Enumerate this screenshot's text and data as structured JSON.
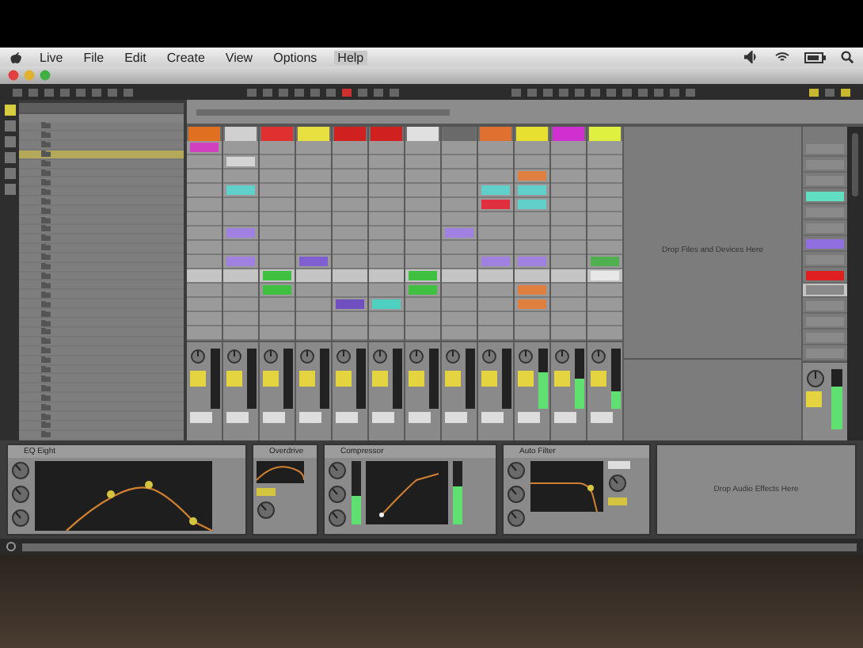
{
  "menu_bar": {
    "items": [
      {
        "label": "Live",
        "selected": false
      },
      {
        "label": "File",
        "selected": false
      },
      {
        "label": "Edit",
        "selected": false
      },
      {
        "label": "Create",
        "selected": false
      },
      {
        "label": "View",
        "selected": false
      },
      {
        "label": "Options",
        "selected": false
      },
      {
        "label": "Help",
        "selected": true
      }
    ]
  },
  "browser": {
    "items": [
      {
        "selected": false
      },
      {
        "selected": false
      },
      {
        "selected": false
      },
      {
        "selected": true
      },
      {
        "selected": false
      },
      {
        "selected": false
      },
      {
        "selected": false
      },
      {
        "selected": false
      },
      {
        "selected": false
      },
      {
        "selected": false
      },
      {
        "selected": false
      },
      {
        "selected": false
      },
      {
        "selected": false
      },
      {
        "selected": false
      },
      {
        "selected": false
      },
      {
        "selected": false
      },
      {
        "selected": false
      },
      {
        "selected": false
      },
      {
        "selected": false
      },
      {
        "selected": false
      },
      {
        "selected": false
      },
      {
        "selected": false
      },
      {
        "selected": false
      },
      {
        "selected": false
      },
      {
        "selected": false
      },
      {
        "selected": false
      },
      {
        "selected": false
      },
      {
        "selected": false
      },
      {
        "selected": false
      },
      {
        "selected": false
      },
      {
        "selected": false
      },
      {
        "selected": false
      },
      {
        "selected": false
      },
      {
        "selected": false
      }
    ]
  },
  "session": {
    "drop_hint": "Drop Files and Devices Here",
    "tracks": [
      {
        "color": "#e07020",
        "level": 0,
        "slots": [
          {
            "clip": true,
            "color": "#d040c0"
          },
          {
            "clip": false
          },
          {
            "clip": false
          },
          {
            "clip": false
          },
          {
            "clip": false
          },
          {
            "clip": false
          },
          {
            "clip": false
          },
          {
            "clip": false
          },
          {
            "clip": false
          },
          {
            "clip": false
          },
          {
            "clip": false
          },
          {
            "clip": false
          },
          {
            "clip": false
          },
          {
            "clip": false
          }
        ]
      },
      {
        "color": "#d0d0d0",
        "level": 0,
        "slots": [
          {
            "clip": false
          },
          {
            "clip": true,
            "color": "#d4d4d4"
          },
          {
            "clip": false
          },
          {
            "clip": true,
            "color": "#60d0c8"
          },
          {
            "clip": false
          },
          {
            "clip": false
          },
          {
            "clip": true,
            "color": "#a080e0"
          },
          {
            "clip": false
          },
          {
            "clip": true,
            "color": "#a080e0"
          },
          {
            "clip": false
          },
          {
            "clip": false
          },
          {
            "clip": false
          },
          {
            "clip": false
          },
          {
            "clip": false
          }
        ]
      },
      {
        "color": "#e03030",
        "level": 0,
        "slots": [
          {
            "clip": false
          },
          {
            "clip": false
          },
          {
            "clip": false
          },
          {
            "clip": false
          },
          {
            "clip": false
          },
          {
            "clip": false
          },
          {
            "clip": false
          },
          {
            "clip": false
          },
          {
            "clip": false
          },
          {
            "clip": true,
            "color": "#40c040"
          },
          {
            "clip": true,
            "color": "#40c040"
          },
          {
            "clip": false
          },
          {
            "clip": false
          },
          {
            "clip": false
          }
        ]
      },
      {
        "color": "#e8e040",
        "level": 0,
        "slots": [
          {
            "clip": false
          },
          {
            "clip": false
          },
          {
            "clip": false
          },
          {
            "clip": false
          },
          {
            "clip": false
          },
          {
            "clip": false
          },
          {
            "clip": false
          },
          {
            "clip": false
          },
          {
            "clip": true,
            "color": "#8060d0"
          },
          {
            "clip": false
          },
          {
            "clip": false
          },
          {
            "clip": false
          },
          {
            "clip": false
          },
          {
            "clip": false
          }
        ]
      },
      {
        "color": "#d02020",
        "level": 0,
        "slots": [
          {
            "clip": false
          },
          {
            "clip": false
          },
          {
            "clip": false
          },
          {
            "clip": false
          },
          {
            "clip": false
          },
          {
            "clip": false
          },
          {
            "clip": false
          },
          {
            "clip": false
          },
          {
            "clip": false
          },
          {
            "clip": false
          },
          {
            "clip": false
          },
          {
            "clip": true,
            "color": "#7050c0"
          },
          {
            "clip": false
          },
          {
            "clip": false
          }
        ]
      },
      {
        "color": "#d02020",
        "level": 0,
        "slots": [
          {
            "clip": false
          },
          {
            "clip": false
          },
          {
            "clip": false
          },
          {
            "clip": false
          },
          {
            "clip": false
          },
          {
            "clip": false
          },
          {
            "clip": false
          },
          {
            "clip": false
          },
          {
            "clip": false
          },
          {
            "clip": false
          },
          {
            "clip": false
          },
          {
            "clip": true,
            "color": "#50d0c0"
          },
          {
            "clip": false
          },
          {
            "clip": false
          }
        ]
      },
      {
        "color": "#e0e0e0",
        "level": 0,
        "slots": [
          {
            "clip": false
          },
          {
            "clip": false
          },
          {
            "clip": false
          },
          {
            "clip": false
          },
          {
            "clip": false
          },
          {
            "clip": false
          },
          {
            "clip": false
          },
          {
            "clip": false
          },
          {
            "clip": false
          },
          {
            "clip": true,
            "color": "#40c040"
          },
          {
            "clip": true,
            "color": "#40c040"
          },
          {
            "clip": false
          },
          {
            "clip": false
          },
          {
            "clip": false
          }
        ]
      },
      {
        "color": "#6a6a6a",
        "level": 0,
        "slots": [
          {
            "clip": false
          },
          {
            "clip": false
          },
          {
            "clip": false
          },
          {
            "clip": false
          },
          {
            "clip": false
          },
          {
            "clip": false
          },
          {
            "clip": true,
            "color": "#a080e0"
          },
          {
            "clip": false
          },
          {
            "clip": false
          },
          {
            "clip": false
          },
          {
            "clip": false
          },
          {
            "clip": false
          },
          {
            "clip": false
          },
          {
            "clip": false
          }
        ]
      },
      {
        "color": "#e07030",
        "level": 0,
        "slots": [
          {
            "clip": false
          },
          {
            "clip": false
          },
          {
            "clip": false
          },
          {
            "clip": true,
            "color": "#60d0c8"
          },
          {
            "clip": true,
            "color": "#e03040"
          },
          {
            "clip": false
          },
          {
            "clip": false
          },
          {
            "clip": false
          },
          {
            "clip": true,
            "color": "#a080e0"
          },
          {
            "clip": false
          },
          {
            "clip": false
          },
          {
            "clip": false
          },
          {
            "clip": false
          },
          {
            "clip": false
          }
        ]
      },
      {
        "color": "#e8e030",
        "level": 0.6,
        "slots": [
          {
            "clip": false
          },
          {
            "clip": false
          },
          {
            "clip": true,
            "color": "#e08040"
          },
          {
            "clip": true,
            "color": "#60d0c8"
          },
          {
            "clip": true,
            "color": "#60d0c8"
          },
          {
            "clip": false
          },
          {
            "clip": false
          },
          {
            "clip": false
          },
          {
            "clip": true,
            "color": "#a080e0"
          },
          {
            "clip": false
          },
          {
            "clip": true,
            "color": "#e08040"
          },
          {
            "clip": true,
            "color": "#e08040"
          },
          {
            "clip": false
          },
          {
            "clip": false
          }
        ]
      },
      {
        "color": "#d030d0",
        "level": 0.5,
        "slots": [
          {
            "clip": false
          },
          {
            "clip": false
          },
          {
            "clip": false
          },
          {
            "clip": false
          },
          {
            "clip": false
          },
          {
            "clip": false
          },
          {
            "clip": false
          },
          {
            "clip": false
          },
          {
            "clip": false
          },
          {
            "clip": false
          },
          {
            "clip": false
          },
          {
            "clip": false
          },
          {
            "clip": false
          },
          {
            "clip": false
          }
        ]
      },
      {
        "color": "#e0f040",
        "level": 0.3,
        "slots": [
          {
            "clip": false
          },
          {
            "clip": false
          },
          {
            "clip": false
          },
          {
            "clip": false
          },
          {
            "clip": false
          },
          {
            "clip": false
          },
          {
            "clip": false
          },
          {
            "clip": false
          },
          {
            "clip": true,
            "color": "#50b050"
          },
          {
            "clip": true,
            "color": "#e8e8e8"
          },
          {
            "clip": false
          },
          {
            "clip": false
          },
          {
            "clip": false
          },
          {
            "clip": false
          }
        ]
      }
    ],
    "scenes": [
      {
        "color": "#8a8a8a",
        "selected": false
      },
      {
        "color": "#8a8a8a",
        "selected": false
      },
      {
        "color": "#8a8a8a",
        "selected": false
      },
      {
        "color": "#60e0c0",
        "selected": false
      },
      {
        "color": "#8a8a8a",
        "selected": false
      },
      {
        "color": "#8a8a8a",
        "selected": false
      },
      {
        "color": "#9070e0",
        "selected": false
      },
      {
        "color": "#8a8a8a",
        "selected": false
      },
      {
        "color": "#e02020",
        "selected": false
      },
      {
        "color": "#8a8a8a",
        "selected": true
      },
      {
        "color": "#8a8a8a",
        "selected": false
      },
      {
        "color": "#8a8a8a",
        "selected": false
      },
      {
        "color": "#8a8a8a",
        "selected": false
      },
      {
        "color": "#8a8a8a",
        "selected": false
      }
    ],
    "master": {
      "level": 0.7
    }
  },
  "devices": {
    "items": [
      {
        "kind": "eq",
        "title": "EQ Eight"
      },
      {
        "kind": "small",
        "title": "Overdrive"
      },
      {
        "kind": "compressor",
        "title": "Compressor"
      },
      {
        "kind": "filter",
        "title": "Auto Filter"
      }
    ],
    "drop_hint": "Drop Audio Effects Here"
  }
}
